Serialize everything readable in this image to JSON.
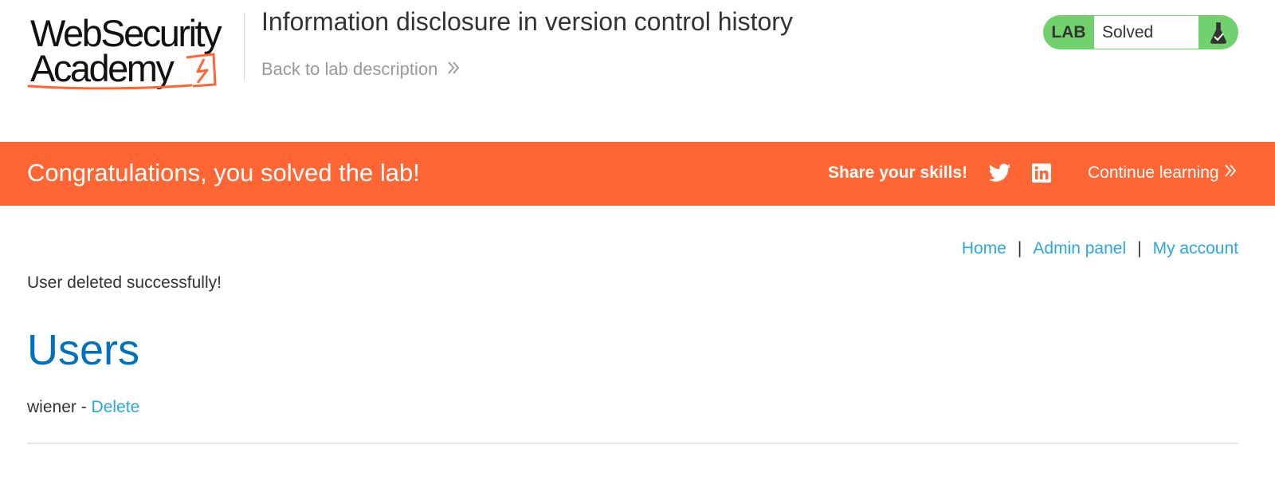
{
  "header": {
    "logo_line1": "WebSecurity",
    "logo_line2": "Academy",
    "lab_title": "Information disclosure in version control history",
    "back_link": "Back to lab description"
  },
  "lab_status": {
    "label": "LAB",
    "state": "Solved"
  },
  "banner": {
    "message": "Congratulations, you solved the lab!",
    "share_label": "Share your skills!",
    "continue_label": "Continue learning"
  },
  "nav": {
    "home": "Home",
    "admin_panel": "Admin panel",
    "my_account": "My account",
    "separator": "|"
  },
  "content": {
    "notice": "User deleted successfully!",
    "heading": "Users",
    "users": [
      {
        "name": "wiener",
        "separator": " - ",
        "action": "Delete"
      }
    ]
  },
  "colors": {
    "brand_orange": "#ff6633",
    "lab_green": "#70d16d",
    "link_blue": "#29a8df",
    "heading_blue": "#0071bc"
  }
}
